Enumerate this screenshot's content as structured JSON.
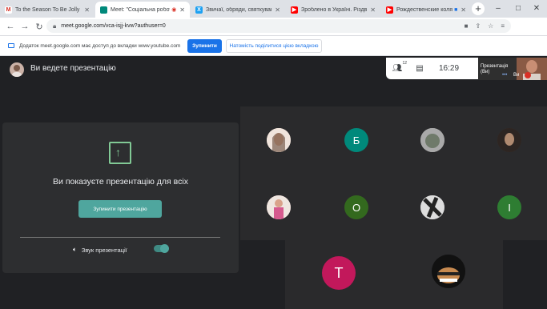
{
  "tabs": [
    {
      "label": "To the Season To Be Jolly 🎁🎄🎁",
      "favicon": "gmail-icon",
      "color": "#d93025",
      "glyph": "M",
      "close": "✕"
    },
    {
      "label": "Meet: \"Соціальна робота і",
      "favicon": "meet-icon",
      "color": "#00897b",
      "glyph": "",
      "close": "✕",
      "active": true
    },
    {
      "label": "Звичаї, обряди, святкування -",
      "favicon": "twitter-icon",
      "color": "#1da1f2",
      "glyph": "X",
      "close": "✕"
    },
    {
      "label": "Зроблено в Україні. Різдвяні",
      "favicon": "youtube-icon",
      "color": "#ff0000",
      "glyph": "▶",
      "close": "✕"
    },
    {
      "label": "Рождественские колядки",
      "favicon": "youtube-icon",
      "color": "#ff0000",
      "glyph": "▶",
      "close": "✕"
    }
  ],
  "newtab": "+",
  "window_controls": [
    "–",
    "□",
    "✕"
  ],
  "url": "meet.google.com/vca-isjj-kvw?authuser=0",
  "infobar": {
    "message": "Додаток meet.google.com має доступ до вкладки www.youtube.com",
    "stop_label": "Зупинити",
    "share_label": "Натомість поділитися цією вкладкою"
  },
  "header": {
    "presenting_title": "Ви ведете презентацію",
    "participants_count": "12",
    "time": "16:29",
    "self_label_1": "Презентація",
    "self_label_2": "(Ви)",
    "self_name": "Ви"
  },
  "present_card": {
    "message": "Ви показуєте презентацію для всіх",
    "stop_button": "Зупинити презентацію",
    "sound_label": "Звук презентації",
    "sound_on": true
  },
  "participants": [
    {
      "initial": "",
      "color": "#e8cfc2"
    },
    {
      "initial": "Б",
      "color": "#00897b"
    },
    {
      "initial": "",
      "color": "#9e9e9e"
    },
    {
      "initial": "",
      "color": "#4a3a30"
    },
    {
      "initial": "",
      "color": "#b07a8a"
    },
    {
      "initial": "О",
      "color": "#33691e"
    },
    {
      "initial": "",
      "color": "#8d8d8d"
    },
    {
      "initial": "І",
      "color": "#2e7d32"
    },
    {
      "initial": "Т",
      "color": "#c2185b"
    },
    {
      "initial": "",
      "color": "#1c1c1c"
    }
  ]
}
